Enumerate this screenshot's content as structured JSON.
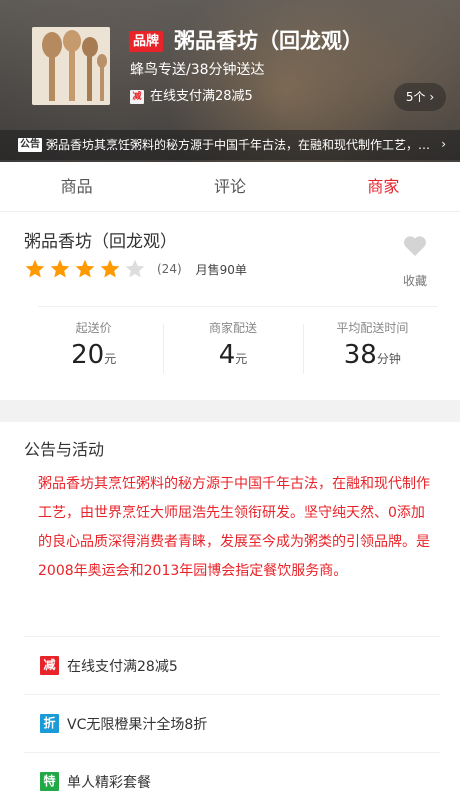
{
  "header": {
    "brand_badge": "品牌",
    "shop_title": "粥品香坊（回龙观）",
    "delivery_text": "蜂鸟专送/38分钟送达",
    "promo_tag": "减",
    "promo_text": "在线支付满28减5",
    "promo_count": "5个 ›",
    "notice_tag": "公告",
    "notice_text": "粥品香坊其烹饪粥料的秘方源于中国千年古法，在融和现代制作工艺，由世界烹饪大师屈浩先生领衔研发。",
    "notice_chevron": "›"
  },
  "tabs": [
    {
      "label": "商品"
    },
    {
      "label": "评论"
    },
    {
      "label": "商家"
    }
  ],
  "shop": {
    "name": "粥品香坊（回龙观）",
    "rating": 4,
    "rating_max": 5,
    "rating_count": "(24)",
    "monthly_sales": "月售90单",
    "favorite_label": "收藏",
    "colors": {
      "star_on": "#ff9900",
      "star_off": "#dddddd",
      "heart": "#d4d4d4"
    }
  },
  "stats": [
    {
      "label": "起送价",
      "value": "20",
      "unit": "元"
    },
    {
      "label": "商家配送",
      "value": "4",
      "unit": "元"
    },
    {
      "label": "平均配送时间",
      "value": "38",
      "unit": "分钟"
    }
  ],
  "announcement": {
    "title": "公告与活动",
    "text": "粥品香坊其烹饪粥料的秘方源于中国千年古法，在融和现代制作工艺，由世界烹饪大师屈浩先生领衔研发。坚守纯天然、0添加的良心品质深得消费者青睐，发展至今成为粥类的引领品牌。是2008年奥运会和2013年园博会指定餐饮服务商。",
    "color": "#e8242a"
  },
  "activities": [
    {
      "icon": "减",
      "text": "在线支付满28减5",
      "color": "#e8242a"
    },
    {
      "icon": "折",
      "text": "VC无限橙果汁全场8折",
      "color": "#1a9bd7"
    },
    {
      "icon": "特",
      "text": "单人精彩套餐",
      "color": "#21a847"
    }
  ]
}
